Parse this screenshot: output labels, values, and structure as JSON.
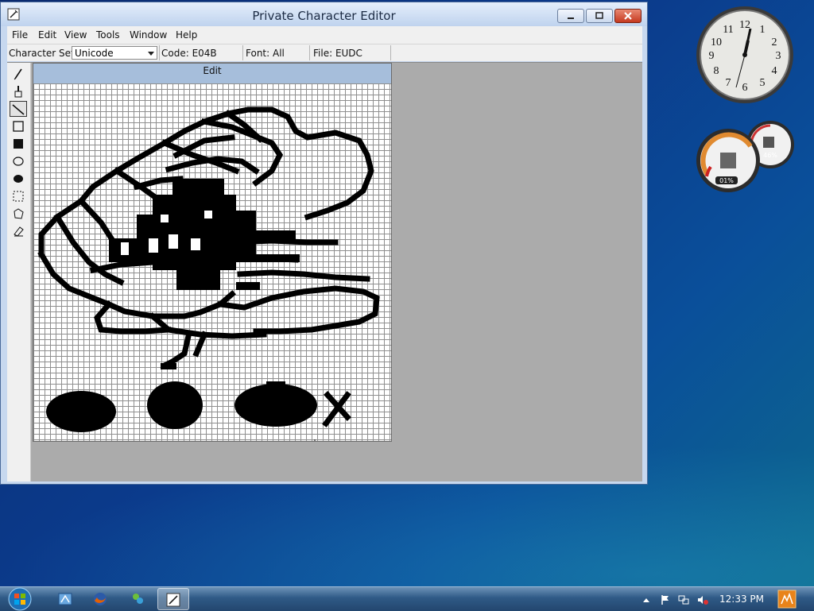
{
  "window": {
    "title": "Private Character Editor",
    "menu": [
      "File",
      "Edit",
      "View",
      "Tools",
      "Window",
      "Help"
    ]
  },
  "toolbar": {
    "charset_label": "Character Set:",
    "charset_value": "Unicode",
    "code": "Code: E04B",
    "font": "Font: All",
    "file": "File: EUDC"
  },
  "edit_pane": {
    "header": "Edit"
  },
  "gadgets": {
    "cpu_meter": {
      "cpu_percent": "01%",
      "memory_percent": "46%"
    },
    "clock": {
      "numerals": [
        "12",
        "1",
        "2",
        "3",
        "4",
        "5",
        "6",
        "7",
        "8",
        "9",
        "10",
        "11"
      ]
    }
  },
  "taskbar": {
    "time": "12:33 PM"
  },
  "colors": {
    "accent": "#a6bedb",
    "desktop": "#0b3b8c"
  }
}
